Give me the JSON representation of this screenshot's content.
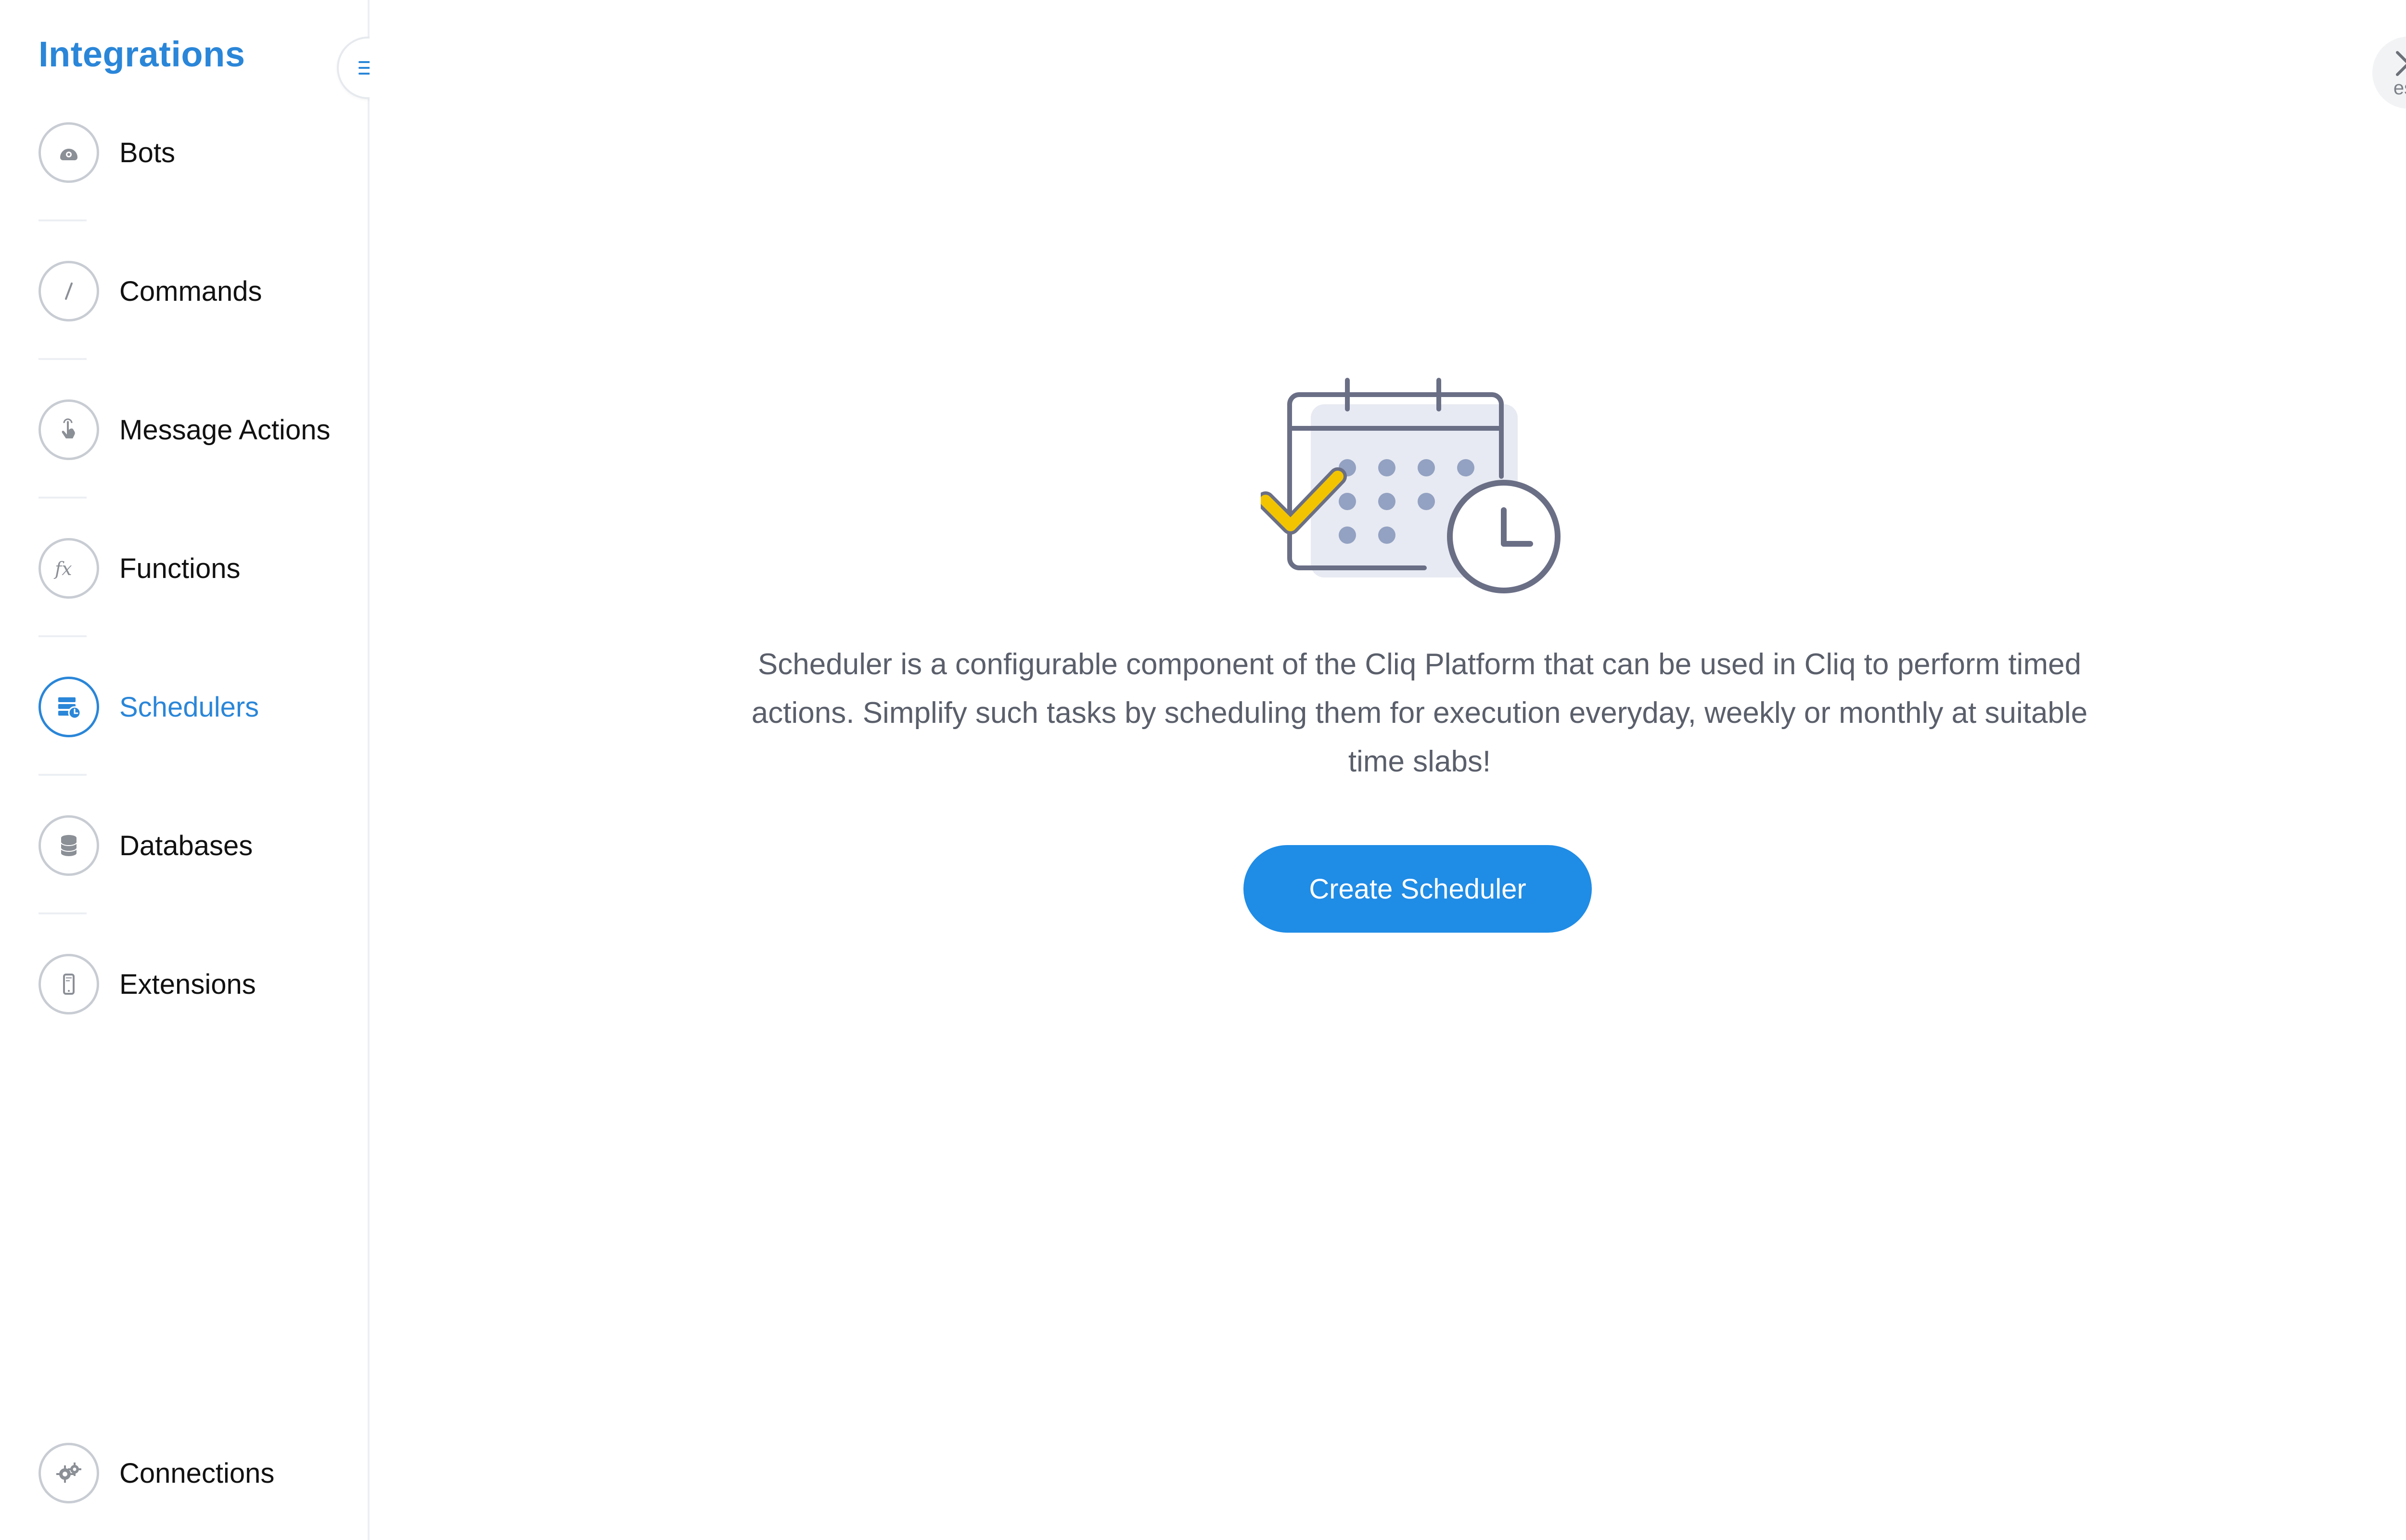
{
  "sidebar": {
    "title": "Integrations",
    "items": [
      {
        "label": "Bots",
        "icon": "bot-icon"
      },
      {
        "label": "Commands",
        "icon": "slash-command-icon"
      },
      {
        "label": "Message Actions",
        "icon": "touch-hand-icon"
      },
      {
        "label": "Functions",
        "icon": "function-fx-icon"
      },
      {
        "label": "Schedulers",
        "icon": "scheduler-icon",
        "active": true
      },
      {
        "label": "Databases",
        "icon": "database-icon"
      },
      {
        "label": "Extensions",
        "icon": "mobile-extension-icon"
      }
    ],
    "bottom_item": {
      "label": "Connections",
      "icon": "gears-icon"
    }
  },
  "header": {
    "close_hint": "esc"
  },
  "main": {
    "description": "Scheduler is a configurable component of the Cliq Platform that can be used in Cliq to perform timed actions. Simplify such tasks by scheduling them for execution everyday, weekly or monthly at suitable time slabs!",
    "cta_label": "Create Scheduler"
  },
  "colors": {
    "accent": "#1f8ce6",
    "title": "#2a86d8",
    "muted_text": "#5a5f6b",
    "icon_border": "#c8ccd3",
    "check": "#f2c400"
  }
}
